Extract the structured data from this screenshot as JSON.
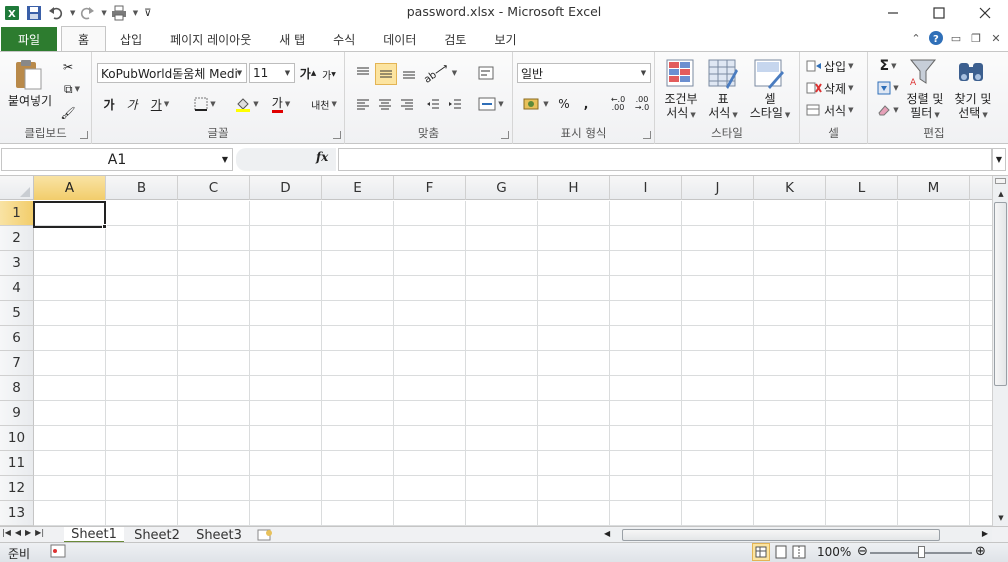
{
  "window": {
    "title": "password.xlsx  -  Microsoft Excel",
    "minimize_icon": "minimize-icon",
    "maximize_icon": "maximize-icon",
    "close_icon": "close-icon"
  },
  "tabs": [
    {
      "label": "파일"
    },
    {
      "label": "홈"
    },
    {
      "label": "삽입"
    },
    {
      "label": "페이지 레이아웃"
    },
    {
      "label": "새 탭"
    },
    {
      "label": "수식"
    },
    {
      "label": "데이터"
    },
    {
      "label": "검토"
    },
    {
      "label": "보기"
    }
  ],
  "ribbon": {
    "clipboard": {
      "paste_label": "붙여넣기",
      "group_label": "클립보드"
    },
    "font": {
      "name": "KoPubWorld돋움체 Medi",
      "size": "11",
      "bold": "가",
      "italic": "가",
      "underline": "가",
      "font_color_glyph": "가",
      "phonetic": "내천",
      "grow": "가",
      "shrink": "가",
      "group_label": "글꼴"
    },
    "alignment": {
      "group_label": "맞춤"
    },
    "number": {
      "format": "일반",
      "percent": "%",
      "comma": ",",
      "inc_decimal": "←.0\n.00",
      "dec_decimal": ".00\n→.0",
      "group_label": "표시 형식"
    },
    "styles": {
      "conditional_label_1": "조건부",
      "conditional_label_2": "서식",
      "table_label_1": "표",
      "table_label_2": "서식",
      "cell_label_1": "셀",
      "cell_label_2": "스타일",
      "group_label": "스타일"
    },
    "cells": {
      "insert": "삽입",
      "delete": "삭제",
      "format": "서식",
      "group_label": "셀"
    },
    "editing": {
      "sort_label_1": "정렬 및",
      "sort_label_2": "필터",
      "find_label_1": "찾기 및",
      "find_label_2": "선택",
      "sum": "Σ",
      "group_label": "편집"
    }
  },
  "formula_bar": {
    "name_box": "A1",
    "fx": "fx",
    "value": ""
  },
  "grid": {
    "columns": [
      "A",
      "B",
      "C",
      "D",
      "E",
      "F",
      "G",
      "H",
      "I",
      "J",
      "K",
      "L",
      "M"
    ],
    "rows": [
      "1",
      "2",
      "3",
      "4",
      "5",
      "6",
      "7",
      "8",
      "9",
      "10",
      "11",
      "12",
      "13"
    ],
    "active_cell": "A1"
  },
  "sheets": [
    {
      "label": "Sheet1",
      "active": true
    },
    {
      "label": "Sheet2",
      "active": false
    },
    {
      "label": "Sheet3",
      "active": false
    }
  ],
  "status": {
    "ready": "준비",
    "zoom": "100%"
  },
  "colors": {
    "file_tab": "#2d7c2f",
    "active_header": "#f2cd6b",
    "gridline": "#dadcdd"
  }
}
